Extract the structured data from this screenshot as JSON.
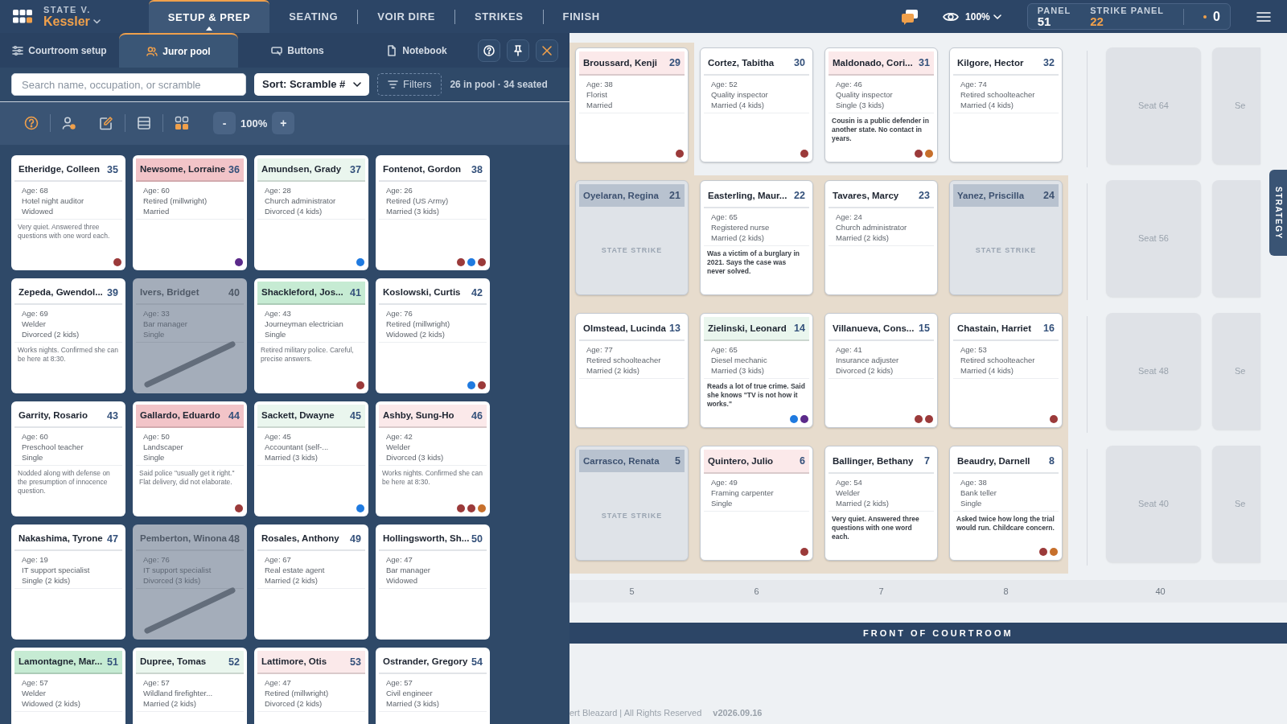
{
  "app": {
    "case_prefix": "STATE V.",
    "case_name": "Kessler"
  },
  "nav_tabs": [
    {
      "label": "SETUP & PREP",
      "selected": true
    },
    {
      "label": "SEATING",
      "selected": false
    },
    {
      "label": "VOIR DIRE",
      "selected": false
    },
    {
      "label": "STRIKES",
      "selected": false
    },
    {
      "label": "FINISH",
      "selected": false
    }
  ],
  "view": {
    "zoom": "100%"
  },
  "panel_counts": [
    {
      "label": "PANEL",
      "value": "51",
      "color": "#ffffff"
    },
    {
      "label": "STRIKE PANEL",
      "value": "22",
      "color": "#f0a04b"
    }
  ],
  "alerts": {
    "count": "0"
  },
  "side_panel": {
    "tabs": [
      {
        "label": "Courtroom setup",
        "selected": false
      },
      {
        "label": "Juror pool",
        "selected": true
      },
      {
        "label": "Buttons",
        "selected": false
      },
      {
        "label": "Notebook",
        "selected": false
      }
    ],
    "search": {
      "placeholder": "Search name, occupation, or scramble"
    },
    "sort": "Sort: Scramble #",
    "filters": "Filters",
    "summary": "26 in pool · 34 seated",
    "toolbar": {
      "decrease": "-",
      "zoom": "100%",
      "increase": "+",
      "grid_view_selected": true
    },
    "jurors": [
      {
        "number": "35",
        "name": "Etheridge, Colleen",
        "struck": false,
        "age": "Age: 68",
        "occupation": "Hotel night auditor",
        "status": "Widowed",
        "note": "Very quiet. Answered three questions with one word each.",
        "flags": [
          {
            "color": "#9b3a3a"
          }
        ]
      },
      {
        "number": "36",
        "name": "Newsome, Lorraine",
        "color": "#f2c4c8",
        "struck": false,
        "age": "Age: 60",
        "occupation": "Retired (millwright)",
        "status": "Married",
        "flags": [
          {
            "color": "#5b2a8a"
          }
        ]
      },
      {
        "number": "37",
        "name": "Amundsen, Grady",
        "color": "#eaf6ee",
        "struck": false,
        "age": "Age: 28",
        "occupation": "Church administrator",
        "status": "Divorced (4 kids)",
        "flags": [
          {
            "color": "#1f7ae0"
          }
        ]
      },
      {
        "number": "38",
        "name": "Fontenot, Gordon",
        "struck": false,
        "age": "Age: 26",
        "occupation": "Retired (US Army)",
        "status": "Married (3 kids)",
        "flags": [
          {
            "color": "#9b3a3a"
          },
          {
            "color": "#1f7ae0"
          },
          {
            "color": "#9b3a3a"
          }
        ]
      },
      {
        "number": "39",
        "name": "Zepeda, Gwendol...",
        "struck": false,
        "age": "Age: 69",
        "occupation": "Welder",
        "status": "Divorced (2 kids)",
        "note": "Works nights. Confirmed she can be here at 8:30."
      },
      {
        "number": "40",
        "name": "Ivers, Bridget",
        "struck": true,
        "age": "Age: 33",
        "occupation": "Bar manager",
        "status": "Single"
      },
      {
        "number": "41",
        "name": "Shackleford, Jos...",
        "color": "#c6ebd3",
        "struck": false,
        "age": "Age: 43",
        "occupation": "Journeyman electrician",
        "status": "Single",
        "note": "Retired military police. Careful, precise answers.",
        "flags": [
          {
            "color": "#9b3a3a"
          }
        ]
      },
      {
        "number": "42",
        "name": "Koslowski, Curtis",
        "struck": false,
        "age": "Age: 76",
        "occupation": "Retired (millwright)",
        "status": "Widowed (2 kids)",
        "flags": [
          {
            "color": "#1f7ae0"
          },
          {
            "color": "#9b3a3a"
          }
        ]
      },
      {
        "number": "43",
        "name": "Garrity, Rosario",
        "struck": false,
        "age": "Age: 60",
        "occupation": "Preschool teacher",
        "status": "Single",
        "note": "Nodded along with defense on the presumption of innocence question."
      },
      {
        "number": "44",
        "name": "Gallardo, Eduardo",
        "color": "#f2c4c8",
        "struck": false,
        "age": "Age: 50",
        "occupation": "Landscaper",
        "status": "Single",
        "note": "Said police \"usually get it right.\" Flat delivery, did not elaborate.",
        "flags": [
          {
            "color": "#9b3a3a"
          }
        ]
      },
      {
        "number": "45",
        "name": "Sackett, Dwayne",
        "color": "#eaf6ee",
        "struck": false,
        "age": "Age: 45",
        "occupation": "Accountant (self-...",
        "status": "Married (3 kids)",
        "flags": [
          {
            "color": "#1f7ae0"
          }
        ]
      },
      {
        "number": "46",
        "name": "Ashby, Sung-Ho",
        "color": "#fbe9ea",
        "struck": false,
        "age": "Age: 42",
        "occupation": "Welder",
        "status": "Divorced (3 kids)",
        "note": "Works nights. Confirmed she can be here at 8:30.",
        "flags": [
          {
            "color": "#9b3a3a"
          },
          {
            "color": "#9b3a3a"
          },
          {
            "color": "#c7702c"
          }
        ]
      },
      {
        "number": "47",
        "name": "Nakashima, Tyrone",
        "struck": false,
        "age": "Age: 19",
        "occupation": "IT support specialist",
        "status": "Single (2 kids)"
      },
      {
        "number": "48",
        "name": "Pemberton, Winona",
        "struck": true,
        "age": "Age: 76",
        "occupation": "IT support specialist",
        "status": "Divorced (3 kids)"
      },
      {
        "number": "49",
        "name": "Rosales, Anthony",
        "struck": false,
        "age": "Age: 67",
        "occupation": "Real estate agent",
        "status": "Married (2 kids)"
      },
      {
        "number": "50",
        "name": "Hollingsworth, Sh...",
        "struck": false,
        "age": "Age: 47",
        "occupation": "Bar manager",
        "status": "Widowed"
      },
      {
        "number": "51",
        "name": "Lamontagne, Mar...",
        "color": "#c6ebd3",
        "struck": false,
        "age": "Age: 57",
        "occupation": "Welder",
        "status": "Widowed (2 kids)"
      },
      {
        "number": "52",
        "name": "Dupree, Tomas",
        "color": "#eaf6ee",
        "struck": false,
        "age": "Age: 57",
        "occupation": "Wildland firefighter...",
        "status": "Married (2 kids)"
      },
      {
        "number": "53",
        "name": "Lattimore, Otis",
        "color": "#fbe9ea",
        "struck": false,
        "age": "Age: 47",
        "occupation": "Retired (millwright)",
        "status": "Divorced (2 kids)"
      },
      {
        "number": "54",
        "name": "Ostrander, Gregory",
        "struck": false,
        "age": "Age: 57",
        "occupation": "Civil engineer",
        "status": "Married (3 kids)"
      }
    ]
  },
  "courtroom": {
    "rows": [
      {
        "seats": [
          {
            "kind": "juror",
            "in_box": true,
            "number": "29",
            "name": "Broussard, Kenji",
            "color": "#fbe9ea",
            "age": "Age: 38",
            "occupation": "Florist",
            "status": "Married",
            "flags": [
              {
                "color": "#9b3a3a"
              }
            ]
          },
          {
            "kind": "juror",
            "in_box": false,
            "number": "30",
            "name": "Cortez, Tabitha",
            "age": "Age: 52",
            "occupation": "Quality inspector",
            "status": "Married (4 kids)",
            "flags": [
              {
                "color": "#9b3a3a"
              }
            ]
          },
          {
            "kind": "juror",
            "in_box": false,
            "number": "31",
            "name": "Maldonado, Cori...",
            "color": "#fbe9ea",
            "age": "Age: 46",
            "occupation": "Quality inspector",
            "status": "Single (3 kids)",
            "note": "Cousin is a public defender in another state. No contact in years.",
            "flags": [
              {
                "color": "#9b3a3a"
              },
              {
                "color": "#c7702c"
              }
            ]
          },
          {
            "kind": "juror",
            "in_box": false,
            "number": "32",
            "name": "Kilgore, Hector",
            "age": "Age: 74",
            "occupation": "Retired schoolteacher",
            "status": "Married (4 kids)"
          }
        ],
        "empty_seats": [
          {
            "kind": "seat",
            "label": "Seat 64"
          },
          {
            "kind": "seat",
            "label": "Se"
          }
        ]
      },
      {
        "seats": [
          {
            "kind": "state-strike",
            "in_box": true,
            "number": "21",
            "name": "Oyelaran, Regina",
            "label": "STATE STRIKE"
          },
          {
            "kind": "juror",
            "in_box": true,
            "number": "22",
            "name": "Easterling, Maur...",
            "age": "Age: 65",
            "occupation": "Registered nurse",
            "status": "Married (2 kids)",
            "note": "Was a victim of a burglary in 2021. Says the case was never solved."
          },
          {
            "kind": "juror",
            "in_box": true,
            "number": "23",
            "name": "Tavares, Marcy",
            "age": "Age: 24",
            "occupation": "Church administrator",
            "status": "Married (2 kids)"
          },
          {
            "kind": "state-strike",
            "in_box": true,
            "number": "24",
            "name": "Yanez, Priscilla",
            "label": "STATE STRIKE"
          }
        ],
        "empty_seats": [
          {
            "kind": "seat",
            "label": "Seat 56"
          },
          {
            "kind": "seat"
          }
        ]
      },
      {
        "seats": [
          {
            "kind": "juror",
            "in_box": true,
            "number": "13",
            "name": "Olmstead, Lucinda",
            "age": "Age: 77",
            "occupation": "Retired schoolteacher",
            "status": "Married (2 kids)"
          },
          {
            "kind": "juror",
            "in_box": true,
            "number": "14",
            "name": "Zielinski, Leonard",
            "color": "#eaf6ee",
            "age": "Age: 65",
            "occupation": "Diesel mechanic",
            "status": "Married (3 kids)",
            "note": "Reads a lot of true crime. Said she knows \"TV is not how it works.\"",
            "flags": [
              {
                "color": "#1f7ae0"
              },
              {
                "color": "#5b2a8a"
              }
            ]
          },
          {
            "kind": "juror",
            "in_box": true,
            "number": "15",
            "name": "Villanueva, Cons...",
            "age": "Age: 41",
            "occupation": "Insurance adjuster",
            "status": "Divorced (2 kids)",
            "flags": [
              {
                "color": "#9b3a3a"
              },
              {
                "color": "#9b3a3a"
              }
            ]
          },
          {
            "kind": "juror",
            "in_box": true,
            "number": "16",
            "name": "Chastain, Harriet",
            "age": "Age: 53",
            "occupation": "Retired schoolteacher",
            "status": "Married (4 kids)",
            "flags": [
              {
                "color": "#9b3a3a"
              }
            ]
          }
        ],
        "empty_seats": [
          {
            "kind": "seat",
            "label": "Seat 48"
          },
          {
            "kind": "seat",
            "label": "Se"
          }
        ]
      },
      {
        "seats": [
          {
            "kind": "state-strike",
            "in_box": true,
            "number": "5",
            "name": "Carrasco, Renata",
            "label": "STATE STRIKE"
          },
          {
            "kind": "juror",
            "in_box": true,
            "number": "6",
            "name": "Quintero, Julio",
            "color": "#fbe9ea",
            "age": "Age: 49",
            "occupation": "Framing carpenter",
            "status": "Single",
            "flags": [
              {
                "color": "#9b3a3a"
              }
            ]
          },
          {
            "kind": "juror",
            "in_box": true,
            "number": "7",
            "name": "Ballinger, Bethany",
            "age": "Age: 54",
            "occupation": "Welder",
            "status": "Married (2 kids)",
            "note": "Very quiet. Answered three questions with one word each."
          },
          {
            "kind": "juror",
            "in_box": true,
            "number": "8",
            "name": "Beaudry, Darnell",
            "age": "Age: 38",
            "occupation": "Bank teller",
            "status": "Single",
            "note": "Asked twice how long the trial would run. Childcare concern.",
            "flags": [
              {
                "color": "#9b3a3a"
              },
              {
                "color": "#c7702c"
              }
            ]
          }
        ],
        "empty_seats": [
          {
            "kind": "seat",
            "label": "Seat 40"
          },
          {
            "kind": "seat",
            "label": "Se"
          }
        ]
      }
    ],
    "column_labels": [
      "5",
      "6",
      "7",
      "8",
      "40"
    ],
    "front_label": "FRONT OF COURTROOM",
    "strategy_tab": "STRATEGY"
  },
  "footer": {
    "credit": "ert Bleazard | All Rights Reserved",
    "version": "v2026.09.16"
  }
}
